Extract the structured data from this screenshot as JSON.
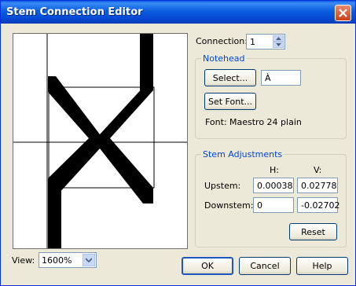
{
  "window": {
    "title": "Stem Connection Editor"
  },
  "connection": {
    "label": "Connection:",
    "value": "1"
  },
  "notehead": {
    "group_title": "Notehead",
    "select_label": "Select...",
    "char_value": "À",
    "set_font_label": "Set Font...",
    "font_label": "Font:",
    "font_value": "Maestro 24 plain"
  },
  "stem": {
    "group_title": "Stem Adjustments",
    "col_h": "H:",
    "col_v": "V:",
    "upstem_label": "Upstem:",
    "upstem_h": "0.00038",
    "upstem_v": "0.02778",
    "downstem_label": "Downstem:",
    "downstem_h": "0",
    "downstem_v": "-0.02702",
    "reset_label": "Reset"
  },
  "view": {
    "label": "View:",
    "value": "1600%"
  },
  "buttons": {
    "ok": "OK",
    "cancel": "Cancel",
    "help": "Help"
  },
  "icons": {
    "close": "close-icon",
    "spin_up": "spin-up-icon",
    "spin_down": "spin-down-icon",
    "dropdown": "chevron-down-icon"
  }
}
